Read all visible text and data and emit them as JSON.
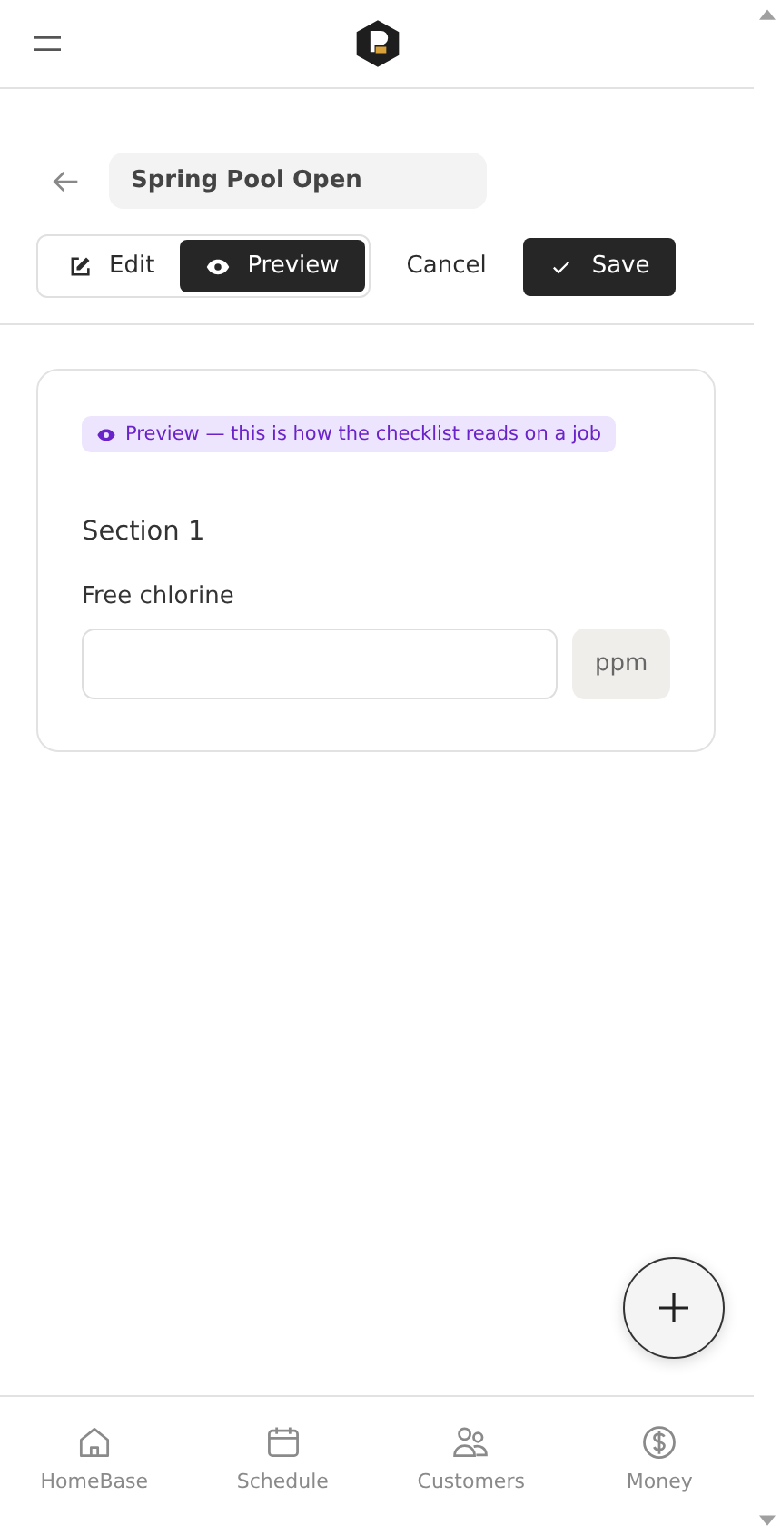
{
  "title_field": {
    "value": "Spring Pool Open"
  },
  "mode_tabs": [
    {
      "kind": "edit",
      "label": "Edit",
      "selected": false
    },
    {
      "kind": "preview",
      "label": "Preview",
      "selected": true
    }
  ],
  "actions": {
    "cancel": "Cancel",
    "save": "Save"
  },
  "card": {
    "banner": "Preview — this is how the checklist reads on a job",
    "section_title": "Section 1",
    "fields": [
      {
        "label": "Free chlorine",
        "unit": "ppm"
      }
    ]
  },
  "bottom_nav": [
    {
      "kind": "home",
      "label": "HomeBase",
      "selected": false
    },
    {
      "kind": "calendar",
      "label": "Schedule",
      "selected": false
    },
    {
      "kind": "people",
      "label": "Customers",
      "selected": false
    },
    {
      "kind": "money",
      "label": "Money",
      "selected": false
    }
  ]
}
